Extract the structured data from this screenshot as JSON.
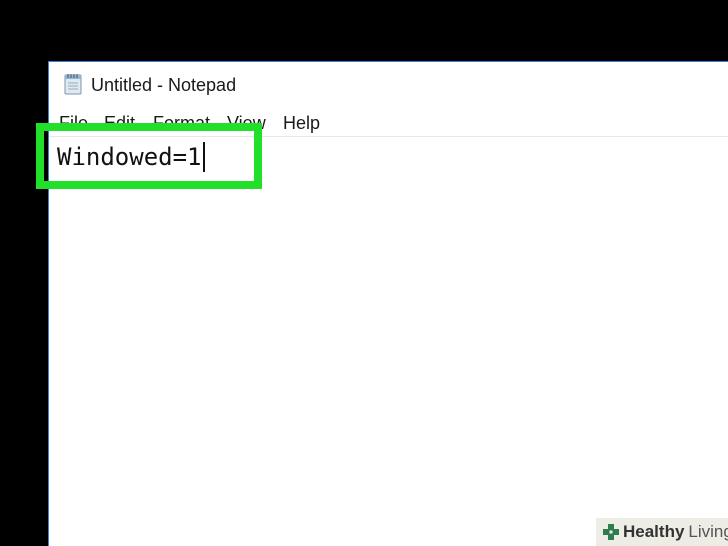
{
  "window": {
    "title": "Untitled - Notepad",
    "app_icon": "notepad-icon"
  },
  "menu": {
    "items": [
      {
        "label": "File"
      },
      {
        "label": "Edit"
      },
      {
        "label": "Format"
      },
      {
        "label": "View"
      },
      {
        "label": "Help"
      }
    ]
  },
  "editor": {
    "content": "Windowed=1"
  },
  "annotation": {
    "highlight_color": "#22e02a"
  },
  "watermark": {
    "brand_bold": "Healthy",
    "brand_light": "Living",
    "icon": "cross-logo-icon"
  },
  "colors": {
    "background": "#000000",
    "window_border": "#3c7fd6",
    "text": "#1a1a1a"
  }
}
